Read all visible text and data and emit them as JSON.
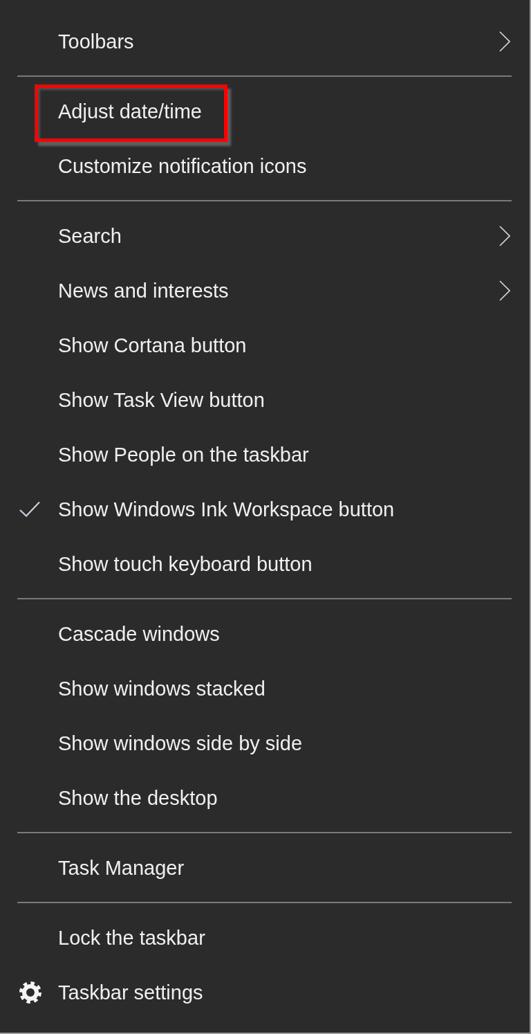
{
  "menu": {
    "sections": [
      {
        "items": [
          {
            "label": "Toolbars",
            "kind": "submenu",
            "checked": false,
            "highlighted": false
          }
        ]
      },
      {
        "items": [
          {
            "label": "Adjust date/time",
            "kind": "command",
            "checked": false,
            "highlighted": true
          },
          {
            "label": "Customize notification icons",
            "kind": "command",
            "checked": false,
            "highlighted": false
          }
        ]
      },
      {
        "items": [
          {
            "label": "Search",
            "kind": "submenu",
            "checked": false,
            "highlighted": false
          },
          {
            "label": "News and interests",
            "kind": "submenu",
            "checked": false,
            "highlighted": false
          },
          {
            "label": "Show Cortana button",
            "kind": "command",
            "checked": false,
            "highlighted": false
          },
          {
            "label": "Show Task View button",
            "kind": "command",
            "checked": false,
            "highlighted": false
          },
          {
            "label": "Show People on the taskbar",
            "kind": "command",
            "checked": false,
            "highlighted": false
          },
          {
            "label": "Show Windows Ink Workspace button",
            "kind": "command",
            "checked": true,
            "highlighted": false
          },
          {
            "label": "Show touch keyboard button",
            "kind": "command",
            "checked": false,
            "highlighted": false
          }
        ]
      },
      {
        "items": [
          {
            "label": "Cascade windows",
            "kind": "command",
            "checked": false,
            "highlighted": false
          },
          {
            "label": "Show windows stacked",
            "kind": "command",
            "checked": false,
            "highlighted": false
          },
          {
            "label": "Show windows side by side",
            "kind": "command",
            "checked": false,
            "highlighted": false
          },
          {
            "label": "Show the desktop",
            "kind": "command",
            "checked": false,
            "highlighted": false
          }
        ]
      },
      {
        "items": [
          {
            "label": "Task Manager",
            "kind": "command",
            "checked": false,
            "highlighted": false
          }
        ]
      },
      {
        "items": [
          {
            "label": "Lock the taskbar",
            "kind": "command",
            "checked": false,
            "highlighted": false
          },
          {
            "label": "Taskbar settings",
            "kind": "settings",
            "checked": false,
            "highlighted": false
          }
        ]
      }
    ]
  }
}
